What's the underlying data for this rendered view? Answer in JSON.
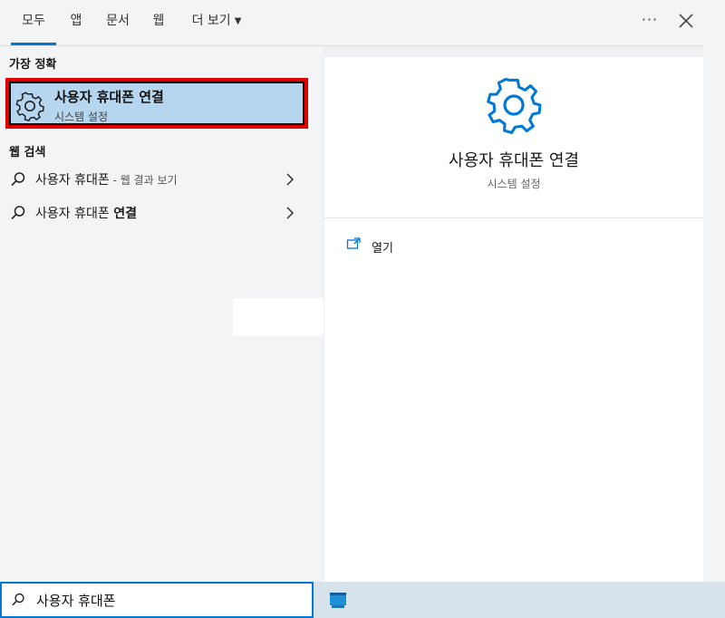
{
  "tabs": [
    {
      "label": "모두",
      "active": true
    },
    {
      "label": "앱",
      "active": false
    },
    {
      "label": "문서",
      "active": false
    },
    {
      "label": "웹",
      "active": false
    },
    {
      "label": "더 보기",
      "active": false,
      "dropdown": true
    }
  ],
  "toolbar": {
    "more_label": "···",
    "close_icon": "close-icon"
  },
  "best_match": {
    "heading": "가장 정확",
    "title": "사용자 휴대폰 연결",
    "subtitle": "시스템 설정",
    "icon": "gear-icon"
  },
  "web_search": {
    "heading": "웹 검색",
    "results": [
      {
        "query": "사용자 휴대폰",
        "hint": " - 웹 결과 보기"
      },
      {
        "query_plain": "사용자 휴대폰 ",
        "query_bold": "연결"
      }
    ]
  },
  "detail": {
    "title": "사용자 휴대폰 연결",
    "subtitle": "시스템 설정",
    "icon": "gear-icon",
    "actions": [
      {
        "label": "열기",
        "icon": "open-window-icon"
      }
    ]
  },
  "search": {
    "value": "사용자 휴대폰",
    "icon": "search-icon"
  },
  "colors": {
    "accent": "#0078d4",
    "highlight_border": "#e10000",
    "selection": "#b6d5ef"
  }
}
